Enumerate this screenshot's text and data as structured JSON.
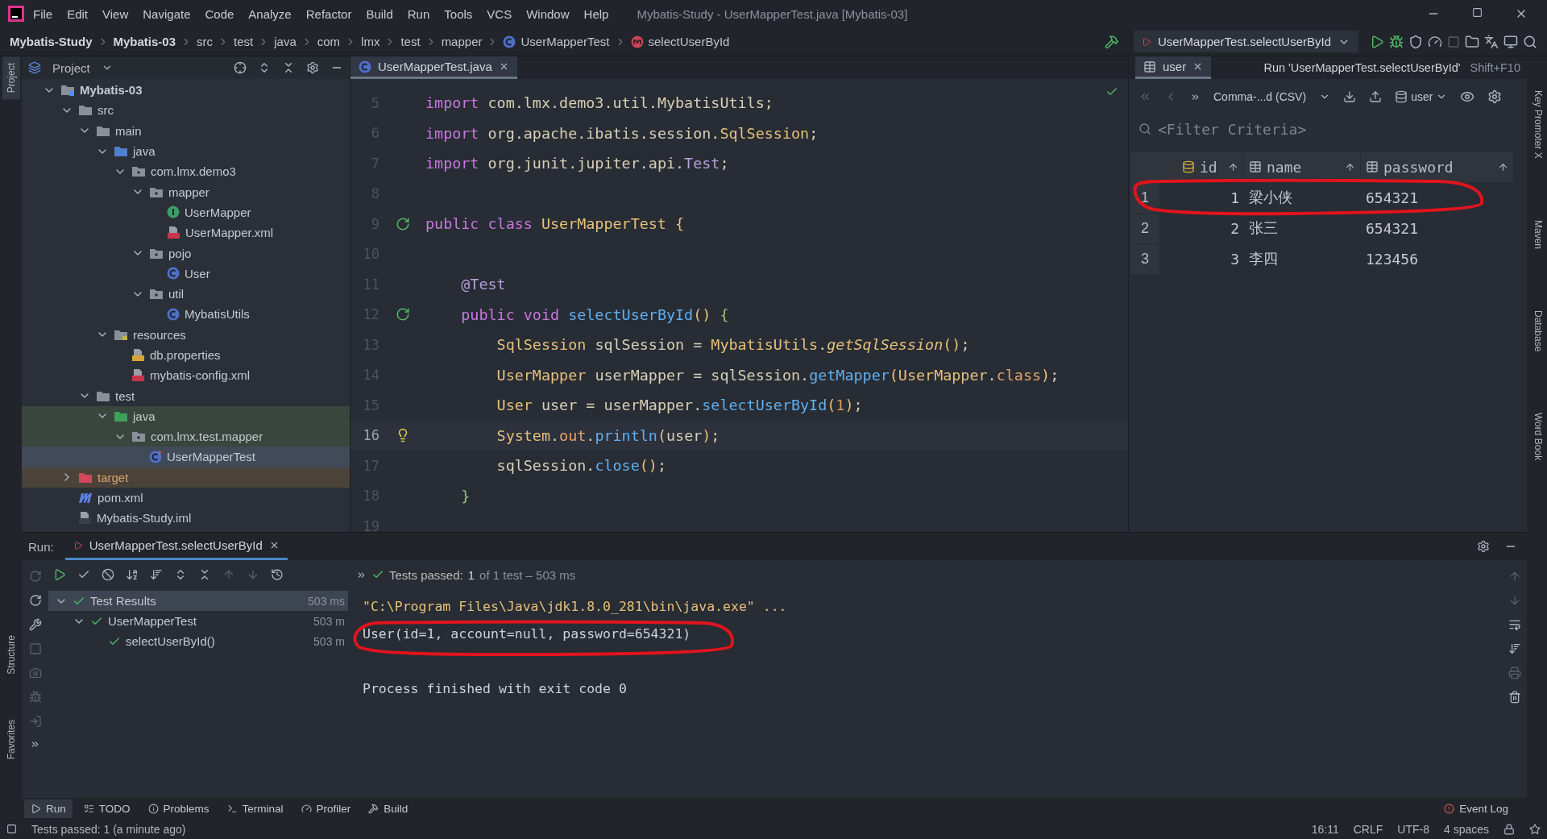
{
  "menu_bar": {
    "items": [
      "File",
      "Edit",
      "View",
      "Navigate",
      "Code",
      "Analyze",
      "Refactor",
      "Build",
      "Run",
      "Tools",
      "VCS",
      "Window",
      "Help"
    ],
    "title": "Mybatis-Study - UserMapperTest.java [Mybatis-03]"
  },
  "nav_bar": {
    "breadcrumbs": [
      {
        "label": "Mybatis-Study",
        "kind": "project"
      },
      {
        "label": "Mybatis-03",
        "kind": "project"
      },
      {
        "label": "src",
        "kind": "folder"
      },
      {
        "label": "test",
        "kind": "folder"
      },
      {
        "label": "java",
        "kind": "folder"
      },
      {
        "label": "com",
        "kind": "folder"
      },
      {
        "label": "lmx",
        "kind": "folder"
      },
      {
        "label": "test",
        "kind": "folder"
      },
      {
        "label": "mapper",
        "kind": "folder"
      },
      {
        "label": "UserMapperTest",
        "kind": "class"
      },
      {
        "label": "selectUserById",
        "kind": "method"
      }
    ],
    "run_config": "UserMapperTest.selectUserById"
  },
  "left_strip": {
    "top": [
      {
        "label": "Project",
        "selected": true
      }
    ],
    "bottom": [
      {
        "label": "Structure",
        "selected": false
      },
      {
        "label": "Favorites",
        "selected": false
      }
    ]
  },
  "right_strip": [
    "Key Promoter X",
    "Maven",
    "Database",
    "Word Book"
  ],
  "project_panel": {
    "title": "Project",
    "tree": [
      {
        "label": "Mybatis-03",
        "kind": "module",
        "expanded": true,
        "children": [
          {
            "label": "src",
            "kind": "folder",
            "expanded": true,
            "children": [
              {
                "label": "main",
                "kind": "folder",
                "expanded": true,
                "children": [
                  {
                    "label": "java",
                    "kind": "source",
                    "expanded": true,
                    "children": [
                      {
                        "label": "com.lmx.demo3",
                        "kind": "package",
                        "expanded": true,
                        "children": [
                          {
                            "label": "mapper",
                            "kind": "package",
                            "expanded": true,
                            "children": [
                              {
                                "label": "UserMapper",
                                "kind": "interface"
                              },
                              {
                                "label": "UserMapper.xml",
                                "kind": "xml"
                              }
                            ]
                          },
                          {
                            "label": "pojo",
                            "kind": "package",
                            "expanded": true,
                            "children": [
                              {
                                "label": "User",
                                "kind": "class"
                              }
                            ]
                          },
                          {
                            "label": "util",
                            "kind": "package",
                            "expanded": true,
                            "children": [
                              {
                                "label": "MybatisUtils",
                                "kind": "class"
                              }
                            ]
                          }
                        ]
                      }
                    ]
                  },
                  {
                    "label": "resources",
                    "kind": "resources",
                    "expanded": true,
                    "children": [
                      {
                        "label": "db.properties",
                        "kind": "properties"
                      },
                      {
                        "label": "mybatis-config.xml",
                        "kind": "xml"
                      }
                    ]
                  }
                ]
              },
              {
                "label": "test",
                "kind": "folder",
                "expanded": true,
                "children": [
                  {
                    "label": "java",
                    "kind": "test-source",
                    "in_test": true,
                    "expanded": true,
                    "children": [
                      {
                        "label": "com.lmx.test.mapper",
                        "kind": "package",
                        "in_test": true,
                        "expanded": true,
                        "children": [
                          {
                            "label": "UserMapperTest",
                            "kind": "test-class",
                            "selected": true
                          }
                        ]
                      }
                    ]
                  }
                ]
              }
            ]
          },
          {
            "label": "target",
            "kind": "excluded",
            "expanded": false
          },
          {
            "label": "pom.xml",
            "kind": "maven"
          },
          {
            "label": "Mybatis-Study.iml",
            "kind": "iml"
          }
        ]
      }
    ]
  },
  "editor": {
    "tab": {
      "label": "UserMapperTest.java",
      "selected": true
    },
    "lines": [
      {
        "number": "5",
        "tokens": [
          {
            "text": "import",
            "kind": "kw"
          },
          {
            "text": " com.lmx.demo3.util.MybatisUtils;",
            "kind": "plain"
          }
        ]
      },
      {
        "number": "6",
        "tokens": [
          {
            "text": "import",
            "kind": "kw"
          },
          {
            "text": " org.apache.ibatis.session.",
            "kind": "plain"
          },
          {
            "text": "SqlSession",
            "kind": "cls"
          },
          {
            "text": ";",
            "kind": "plain"
          }
        ]
      },
      {
        "number": "7",
        "tokens": [
          {
            "text": "import",
            "kind": "kw"
          },
          {
            "text": " org.junit.jupiter.api.",
            "kind": "plain"
          },
          {
            "text": "Test",
            "kind": "anno"
          },
          {
            "text": ";",
            "kind": "plain"
          }
        ]
      },
      {
        "number": "8"
      },
      {
        "number": "9",
        "runnable": true,
        "tokens": [
          {
            "text": "public class ",
            "kind": "kw"
          },
          {
            "text": "UserMapperTest",
            "kind": "cls"
          },
          {
            "text": " {",
            "kind": "paren"
          }
        ]
      },
      {
        "number": "10"
      },
      {
        "number": "11",
        "tokens": [
          {
            "text": "    @Test",
            "kind": "anno"
          }
        ]
      },
      {
        "number": "12",
        "runnable": true,
        "tokens": [
          {
            "text": "    public void ",
            "kind": "kw"
          },
          {
            "text": "selectUserById",
            "kind": "method"
          },
          {
            "text": "()",
            "kind": "paren"
          },
          {
            "text": " {",
            "kind": "brace"
          }
        ]
      },
      {
        "number": "13",
        "tokens": [
          {
            "text": "        SqlSession",
            "kind": "cls"
          },
          {
            "text": " sqlSession = ",
            "kind": "plain"
          },
          {
            "text": "MybatisUtils",
            "kind": "cls"
          },
          {
            "text": ".",
            "kind": "plain"
          },
          {
            "text": "getSqlSession",
            "kind": "static"
          },
          {
            "text": "()",
            "kind": "paren"
          },
          {
            "text": ";",
            "kind": "plain"
          }
        ]
      },
      {
        "number": "14",
        "tokens": [
          {
            "text": "        UserMapper",
            "kind": "cls"
          },
          {
            "text": " userMapper = sqlSession.",
            "kind": "plain"
          },
          {
            "text": "getMapper",
            "kind": "method"
          },
          {
            "text": "(",
            "kind": "paren"
          },
          {
            "text": "UserMapper",
            "kind": "cls"
          },
          {
            "text": ".",
            "kind": "plain"
          },
          {
            "text": "class",
            "kind": "field"
          },
          {
            "text": ")",
            "kind": "paren"
          },
          {
            "text": ";",
            "kind": "plain"
          }
        ]
      },
      {
        "number": "15",
        "tokens": [
          {
            "text": "        User",
            "kind": "cls"
          },
          {
            "text": " user = userMapper.",
            "kind": "plain"
          },
          {
            "text": "selectUserById",
            "kind": "method"
          },
          {
            "text": "(",
            "kind": "paren"
          },
          {
            "text": "1",
            "kind": "num"
          },
          {
            "text": ")",
            "kind": "paren"
          },
          {
            "text": ";",
            "kind": "plain"
          }
        ]
      },
      {
        "number": "16",
        "intention": true,
        "current": true,
        "tokens": [
          {
            "text": "        System",
            "kind": "cls"
          },
          {
            "text": ".",
            "kind": "plain"
          },
          {
            "text": "out",
            "kind": "field"
          },
          {
            "text": ".",
            "kind": "plain"
          },
          {
            "text": "println",
            "kind": "method"
          },
          {
            "text": "(",
            "kind": "paren"
          },
          {
            "text": "user",
            "kind": "plain"
          },
          {
            "text": ")",
            "kind": "paren"
          },
          {
            "text": ";",
            "kind": "plain"
          }
        ]
      },
      {
        "number": "17",
        "tokens": [
          {
            "text": "        sqlSession.",
            "kind": "plain"
          },
          {
            "text": "close",
            "kind": "method"
          },
          {
            "text": "()",
            "kind": "paren"
          },
          {
            "text": ";",
            "kind": "plain"
          }
        ]
      },
      {
        "number": "18",
        "tokens": [
          {
            "text": "    }",
            "kind": "brace"
          }
        ]
      },
      {
        "number": "19"
      }
    ]
  },
  "tooltip": {
    "text": "Run 'UserMapperTest.selectUserById'",
    "shortcut": "Shift+F10"
  },
  "db_panel": {
    "tab": {
      "label": "user",
      "selected": true
    },
    "format": "Comma-...d (CSV)",
    "schema": "user",
    "filter": {
      "placeholder": "<Filter Criteria>"
    },
    "columns": [
      {
        "label": "id",
        "kind": "key"
      },
      {
        "label": "name",
        "kind": "column"
      },
      {
        "label": "password",
        "kind": "column"
      }
    ],
    "rows": [
      {
        "number": "1",
        "cells": [
          "1",
          "梁小侠",
          "654321"
        ]
      },
      {
        "number": "2",
        "cells": [
          "2",
          "张三",
          "654321"
        ]
      },
      {
        "number": "3",
        "cells": [
          "3",
          "李四",
          "123456"
        ]
      }
    ]
  },
  "run_panel": {
    "label": "Run:",
    "tab": {
      "label": "UserMapperTest.selectUserById",
      "selected": true
    },
    "summary": {
      "label": "Tests passed:",
      "count": "1",
      "detail": "of 1 test – 503 ms"
    },
    "tree": [
      {
        "label": "Test Results",
        "time": "503 ms",
        "passed": true,
        "selected": true,
        "expanded": true,
        "children": [
          {
            "label": "UserMapperTest",
            "time": "503 m",
            "passed": true,
            "selected": false,
            "expanded": true,
            "children": [
              {
                "label": "selectUserById()",
                "time": "503 m",
                "passed": true,
                "selected": false
              }
            ]
          }
        ]
      }
    ],
    "console": [
      {
        "kind": "command",
        "text": "\"C:\\Program Files\\Java\\jdk1.8.0_281\\bin\\java.exe\" ..."
      },
      {
        "kind": "output",
        "text": "User(id=1, account=null, password=654321)"
      },
      {
        "kind": "blank"
      },
      {
        "kind": "output",
        "text": "Process finished with exit code 0"
      }
    ]
  },
  "bottom_tabs": [
    {
      "label": "Run",
      "kind": "run",
      "selected": true
    },
    {
      "label": "TODO",
      "kind": "todo",
      "selected": false
    },
    {
      "label": "Problems",
      "kind": "problems",
      "selected": false
    },
    {
      "label": "Terminal",
      "kind": "terminal",
      "selected": false
    },
    {
      "label": "Profiler",
      "kind": "profiler",
      "selected": false
    },
    {
      "label": "Build",
      "kind": "build",
      "selected": false
    }
  ],
  "event_log": "Event Log",
  "status_bar": {
    "message": "Tests passed: 1 (a minute ago)",
    "items": [
      "16:11",
      "CRLF",
      "UTF-8",
      "4 spaces"
    ]
  }
}
